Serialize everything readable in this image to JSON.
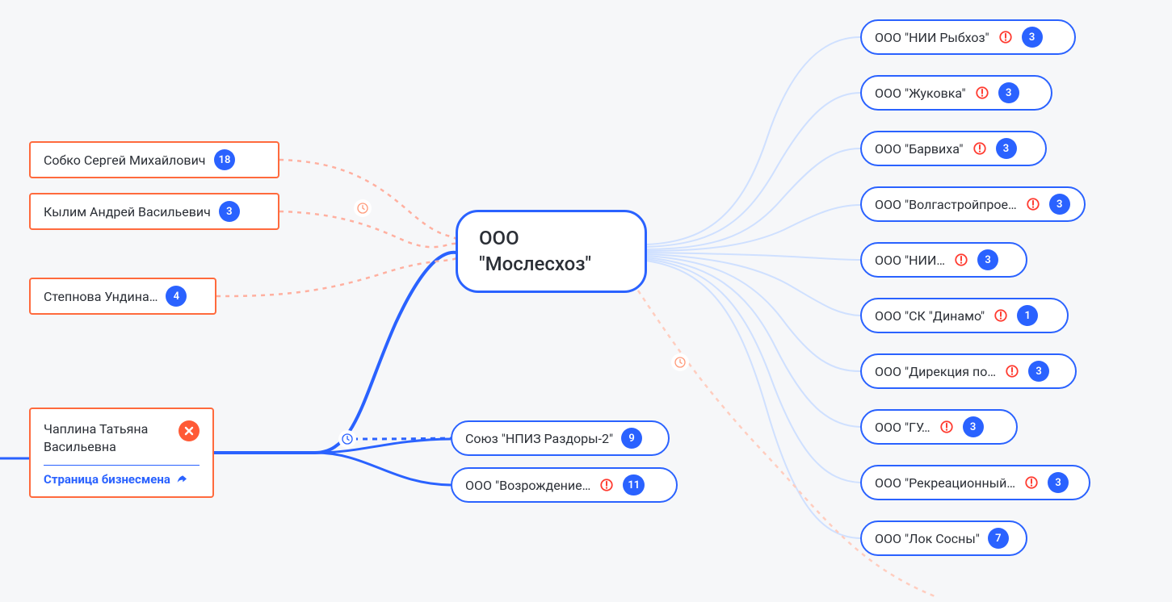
{
  "center": {
    "title": "ООО \"Мослесхоз\""
  },
  "left_people": [
    {
      "name": "Собко Сергей Михайлович",
      "count": 18
    },
    {
      "name": "Кылим Андрей Васильевич",
      "count": 3
    },
    {
      "name": "Степнова Ундина…",
      "count": 4
    }
  ],
  "selected_person": {
    "name": "Чаплина Татьяна Васильевна",
    "link_text": "Страница бизнесмена"
  },
  "middle_orgs": [
    {
      "name": "Союз \"НПИЗ Раздоры-2\"",
      "alert": false,
      "count": 9
    },
    {
      "name": "ООО \"Возрождение…",
      "alert": true,
      "count": 11
    }
  ],
  "right_orgs": [
    {
      "name": "ООО \"НИИ Рыбхоз\"",
      "alert": true,
      "count": 3
    },
    {
      "name": "ООО \"Жуковка\"",
      "alert": true,
      "count": 3
    },
    {
      "name": "ООО \"Барвиха\"",
      "alert": true,
      "count": 3
    },
    {
      "name": "ООО \"Волгастройпрое…",
      "alert": true,
      "count": 3
    },
    {
      "name": "ООО \"НИИ…",
      "alert": true,
      "count": 3
    },
    {
      "name": "ООО \"СК \"Динамо\"",
      "alert": true,
      "count": 1
    },
    {
      "name": "ООО \"Дирекция по…",
      "alert": true,
      "count": 3
    },
    {
      "name": "ООО \"ГУ…",
      "alert": true,
      "count": 3
    },
    {
      "name": "ООО \"Рекреационный…",
      "alert": true,
      "count": 3
    },
    {
      "name": "ООО \"Лок Сосны\"",
      "alert": false,
      "count": 7
    }
  ]
}
